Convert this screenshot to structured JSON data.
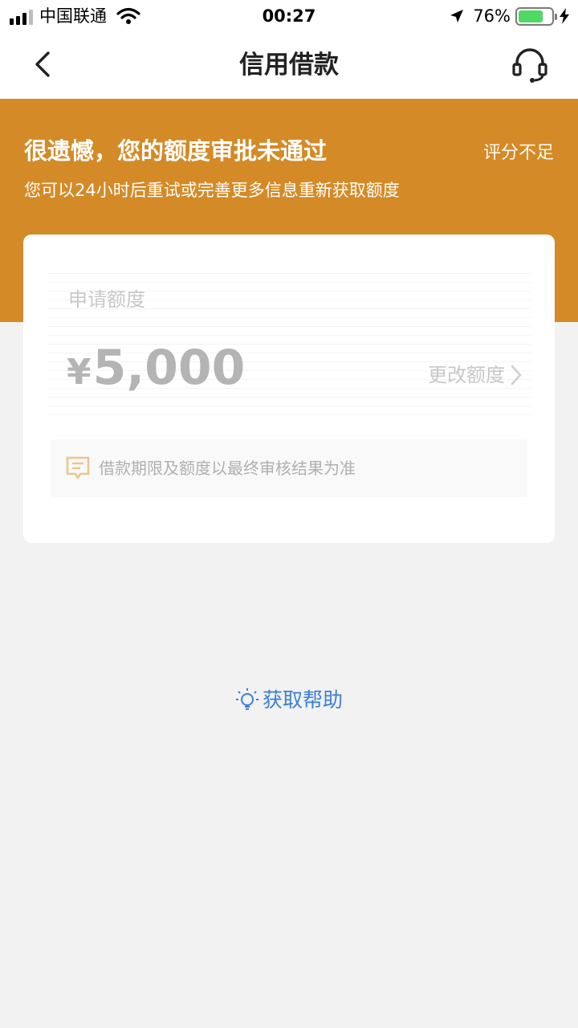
{
  "status_bar": {
    "carrier": "中国联通",
    "time": "00:27",
    "battery_percent": "76%",
    "battery_level": 0.76,
    "battery_color": "#4cd964"
  },
  "nav": {
    "title": "信用借款",
    "back_icon": "chevron-left-icon",
    "service_icon": "headset-icon"
  },
  "result_banner": {
    "title": "很遗憾，您的额度审批未通过",
    "reason": "评分不足",
    "subtitle": "您可以24小时后重试或完善更多信息重新获取额度",
    "background": "#d48a26"
  },
  "card": {
    "apply_label": "申请额度",
    "currency_symbol": "¥",
    "amount": "5,000",
    "change_label": "更改额度",
    "notice": "借款期限及额度以最终审核结果为准"
  },
  "help": {
    "label": "获取帮助",
    "icon": "lightbulb-icon",
    "color": "#3a7fd5"
  }
}
